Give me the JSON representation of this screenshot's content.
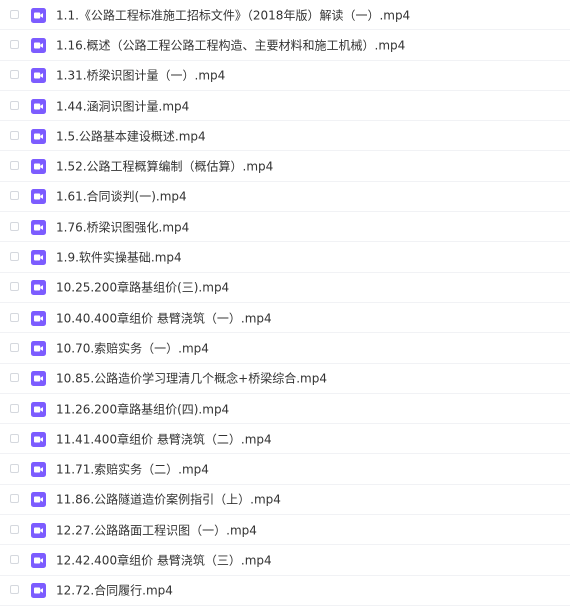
{
  "colors": {
    "icon_purple": "#7C5CFF",
    "text": "#333333",
    "divider": "#F1F2F5"
  },
  "files": [
    {
      "name": "1.1.《公路工程标准施工招标文件》（2018年版）解读（一）.mp4",
      "icon": "video-file-icon"
    },
    {
      "name": "1.16.概述（公路工程公路工程构造、主要材料和施工机械）.mp4",
      "icon": "video-file-icon"
    },
    {
      "name": "1.31.桥梁识图计量（一）.mp4",
      "icon": "video-file-icon"
    },
    {
      "name": "1.44.涵洞识图计量.mp4",
      "icon": "video-file-icon"
    },
    {
      "name": "1.5.公路基本建设概述.mp4",
      "icon": "video-file-icon"
    },
    {
      "name": "1.52.公路工程概算编制（概估算）.mp4",
      "icon": "video-file-icon"
    },
    {
      "name": "1.61.合同谈判(一).mp4",
      "icon": "video-file-icon"
    },
    {
      "name": "1.76.桥梁识图强化.mp4",
      "icon": "video-file-icon"
    },
    {
      "name": "1.9.软件实操基础.mp4",
      "icon": "video-file-icon"
    },
    {
      "name": "10.25.200章路基组价(三).mp4",
      "icon": "video-file-icon"
    },
    {
      "name": "10.40.400章组价 悬臂浇筑（一）.mp4",
      "icon": "video-file-icon"
    },
    {
      "name": "10.70.索赔实务（一）.mp4",
      "icon": "video-file-icon"
    },
    {
      "name": "10.85.公路造价学习理清几个概念+桥梁综合.mp4",
      "icon": "video-file-icon"
    },
    {
      "name": "11.26.200章路基组价(四).mp4",
      "icon": "video-file-icon"
    },
    {
      "name": "11.41.400章组价 悬臂浇筑（二）.mp4",
      "icon": "video-file-icon"
    },
    {
      "name": "11.71.索赔实务（二）.mp4",
      "icon": "video-file-icon"
    },
    {
      "name": "11.86.公路隧道造价案例指引（上）.mp4",
      "icon": "video-file-icon"
    },
    {
      "name": "12.27.公路路面工程识图（一）.mp4",
      "icon": "video-file-icon"
    },
    {
      "name": "12.42.400章组价 悬臂浇筑（三）.mp4",
      "icon": "video-file-icon"
    },
    {
      "name": "12.72.合同履行.mp4",
      "icon": "video-file-icon"
    }
  ]
}
